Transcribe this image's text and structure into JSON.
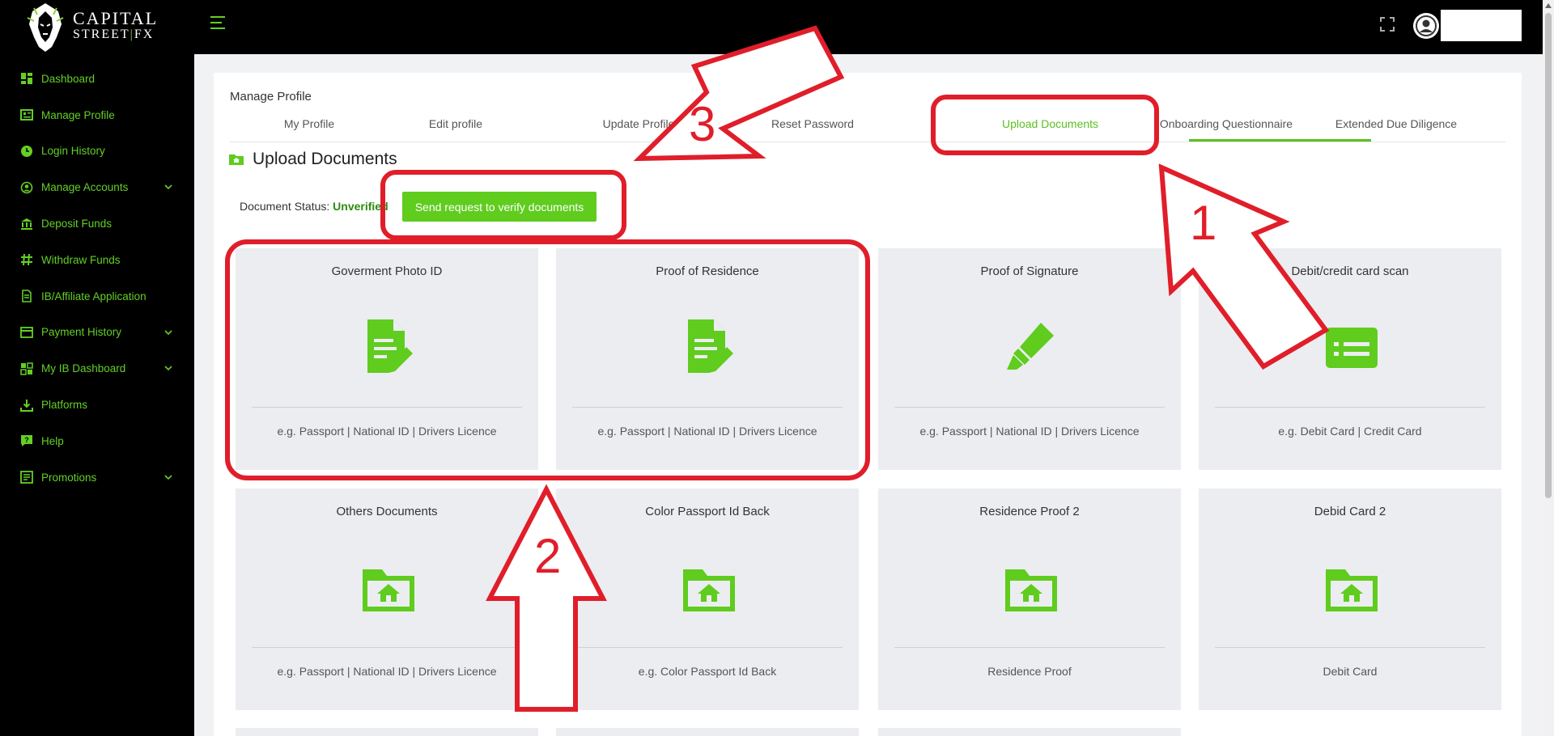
{
  "brand": {
    "line1": "CAPITAL",
    "line2a": "STREET",
    "line2sep": "|",
    "line2b": "FX"
  },
  "sidebar": {
    "items": [
      {
        "label": "Dashboard",
        "icon": "dashboard-icon",
        "expandable": false
      },
      {
        "label": "Manage Profile",
        "icon": "profile-card-icon",
        "expandable": false
      },
      {
        "label": "Login History",
        "icon": "clock-icon",
        "expandable": false
      },
      {
        "label": "Manage Accounts",
        "icon": "user-circle-icon",
        "expandable": true
      },
      {
        "label": "Deposit Funds",
        "icon": "bank-icon",
        "expandable": false
      },
      {
        "label": "Withdraw Funds",
        "icon": "hash-icon",
        "expandable": false
      },
      {
        "label": "IB/Affiliate Application",
        "icon": "document-icon",
        "expandable": false
      },
      {
        "label": "Payment History",
        "icon": "wallet-icon",
        "expandable": true
      },
      {
        "label": "My IB Dashboard",
        "icon": "grid-icon",
        "expandable": true
      },
      {
        "label": "Platforms",
        "icon": "download-icon",
        "expandable": false
      },
      {
        "label": "Help",
        "icon": "chat-help-icon",
        "expandable": false
      },
      {
        "label": "Promotions",
        "icon": "promo-icon",
        "expandable": true
      }
    ]
  },
  "page": {
    "title": "Manage Profile",
    "tabs": [
      {
        "label": "My Profile"
      },
      {
        "label": "Edit profile"
      },
      {
        "label": "Update Profile"
      },
      {
        "label": "Reset Password"
      },
      {
        "label": "Upload Documents",
        "active": true
      },
      {
        "label": "Onboarding Questionnaire"
      },
      {
        "label": "Extended Due Diligence"
      }
    ],
    "section_title": "Upload Documents",
    "status_label": "Document Status:",
    "status_value": "Unverified",
    "verify_button": "Send request to verify documents"
  },
  "documents": [
    {
      "title": "Goverment Photo ID",
      "icon": "file-edit-icon",
      "hint": "e.g. Passport | National ID | Drivers Licence"
    },
    {
      "title": "Proof of Residence",
      "icon": "file-edit-icon",
      "hint": "e.g. Passport | National ID | Drivers Licence"
    },
    {
      "title": "Proof of Signature",
      "icon": "highlighter-icon",
      "hint": "e.g. Passport | National ID | Drivers Licence"
    },
    {
      "title": "Debit/credit card scan",
      "icon": "card-icon",
      "hint": "e.g. Debit Card | Credit Card"
    },
    {
      "title": "Others Documents",
      "icon": "folder-home-icon",
      "hint": "e.g. Passport | National ID | Drivers Licence"
    },
    {
      "title": "Color Passport Id Back",
      "icon": "folder-home-icon",
      "hint": "e.g. Color Passport Id Back"
    },
    {
      "title": "Residence Proof 2",
      "icon": "folder-home-icon",
      "hint": "Residence Proof"
    },
    {
      "title": "Debid Card 2",
      "icon": "folder-home-icon",
      "hint": "Debit Card"
    }
  ],
  "annotations": {
    "labels": [
      "1",
      "2",
      "3"
    ],
    "color": "#e01e2a"
  },
  "colors": {
    "accent": "#5fcc1e",
    "sidebar_text": "#64d025",
    "status_value": "#2c8c10",
    "card_bg": "#ecedf0"
  }
}
